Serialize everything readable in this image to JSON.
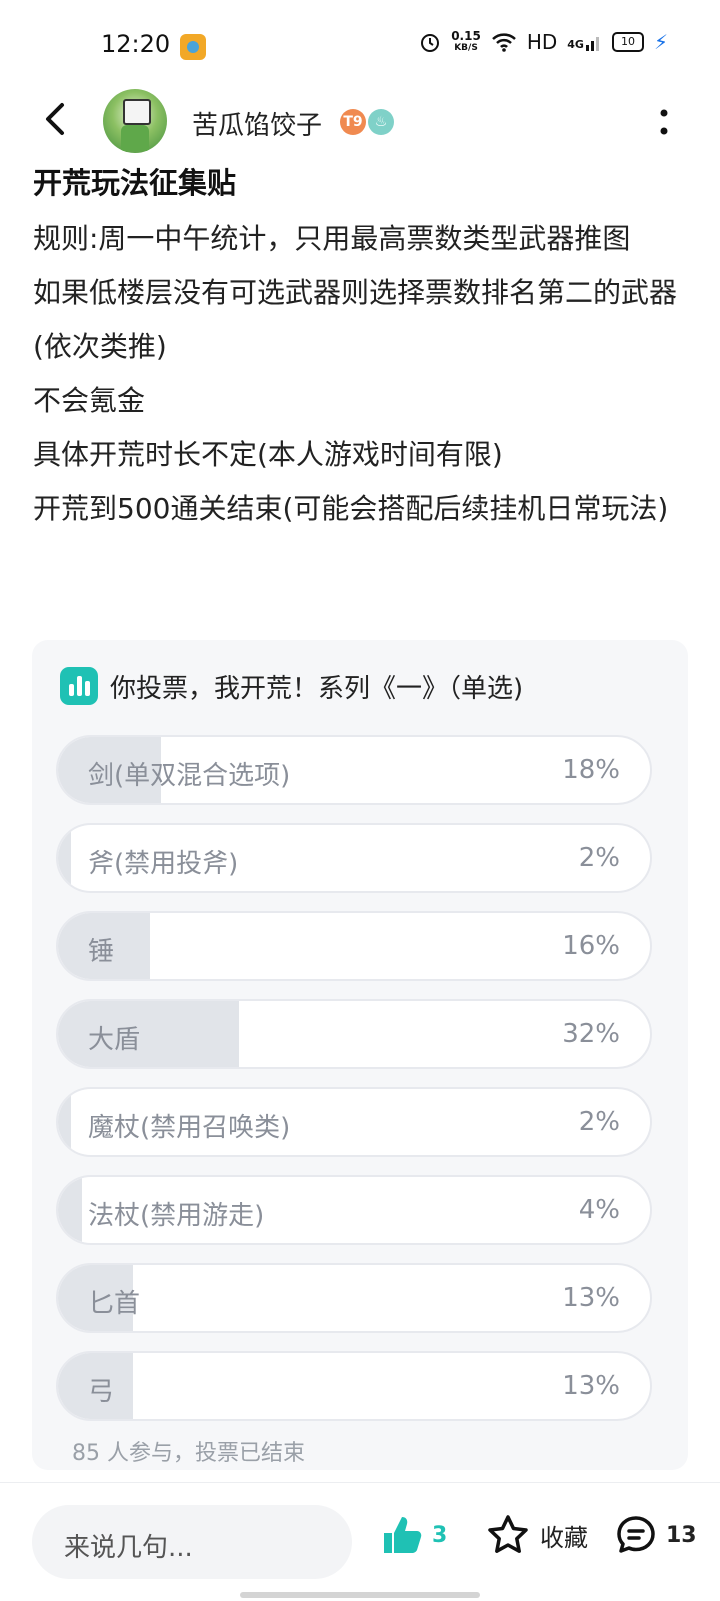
{
  "status_bar": {
    "time": "12:20",
    "speed_value": "0.15",
    "speed_unit": "KB/S",
    "hd": "HD",
    "network": "4G",
    "battery": "10"
  },
  "header": {
    "username": "苦瓜馅饺子",
    "level_badge": "T9"
  },
  "post": {
    "title": "开荒玩法征集贴",
    "lines": [
      "规则:周一中午统计，只用最高票数类型武器推图",
      "如果低楼层没有可选武器则选择票数排名第二的武器(依次类推)",
      "不会氪金",
      "具体开荒时长不定(本人游戏时间有限)",
      "开荒到500通关结束(可能会搭配后续挂机日常玩法)"
    ]
  },
  "poll": {
    "title": "你投票，我开荒！系列《一》（单选)",
    "options": [
      {
        "label": "剑(单双混合选项)",
        "percent": "18%",
        "value": 18
      },
      {
        "label": "斧(禁用投斧)",
        "percent": "2%",
        "value": 2
      },
      {
        "label": "锤",
        "percent": "16%",
        "value": 16
      },
      {
        "label": "大盾",
        "percent": "32%",
        "value": 32
      },
      {
        "label": "魔杖(禁用召唤类)",
        "percent": "2%",
        "value": 2
      },
      {
        "label": "法杖(禁用游走)",
        "percent": "4%",
        "value": 4
      },
      {
        "label": "匕首",
        "percent": "13%",
        "value": 13
      },
      {
        "label": "弓",
        "percent": "13%",
        "value": 13
      }
    ],
    "footer": "85 人参与，投票已结束"
  },
  "bottom_bar": {
    "comment_placeholder": "来说几句...",
    "like_count": "3",
    "favorite_label": "收藏",
    "comment_count": "13"
  },
  "colors": {
    "accent": "#1fc1b4",
    "poll_fill": "#e1e4e9",
    "card_bg": "#f6f7f9"
  }
}
